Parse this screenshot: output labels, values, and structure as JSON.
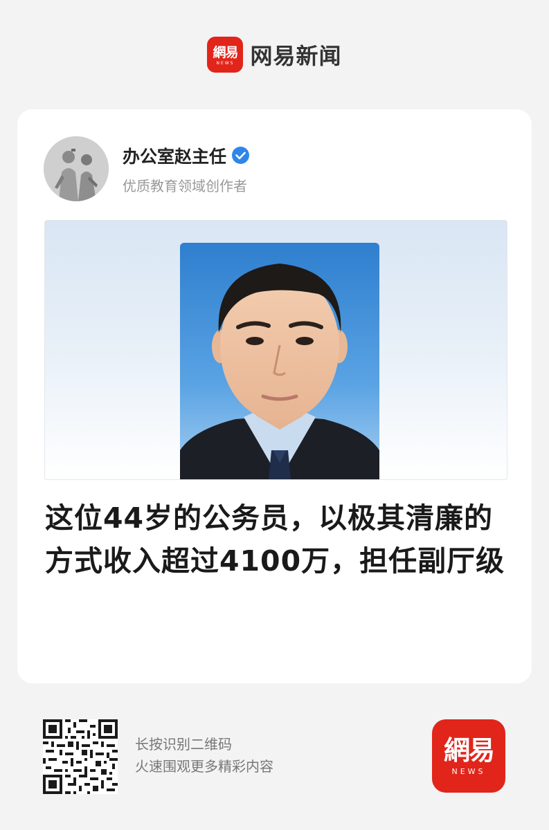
{
  "header": {
    "logo_text": "網易",
    "logo_sub": "NEWS",
    "app_name": "网易新闻"
  },
  "author": {
    "name": "办公室赵主任",
    "description": "优质教育领域创作者",
    "verified": true
  },
  "article": {
    "headline": "这位44岁的公务员，以极其清廉的方式收入超过4100万，担任副厅级"
  },
  "footer": {
    "qr_line1": "长按识别二维码",
    "qr_line2": "火速围观更多精彩内容",
    "logo_text": "網易",
    "logo_sub": "NEWS"
  },
  "colors": {
    "brand_red": "#e1251b",
    "verified_blue": "#2f86e9",
    "background": "#f3f3f4"
  }
}
